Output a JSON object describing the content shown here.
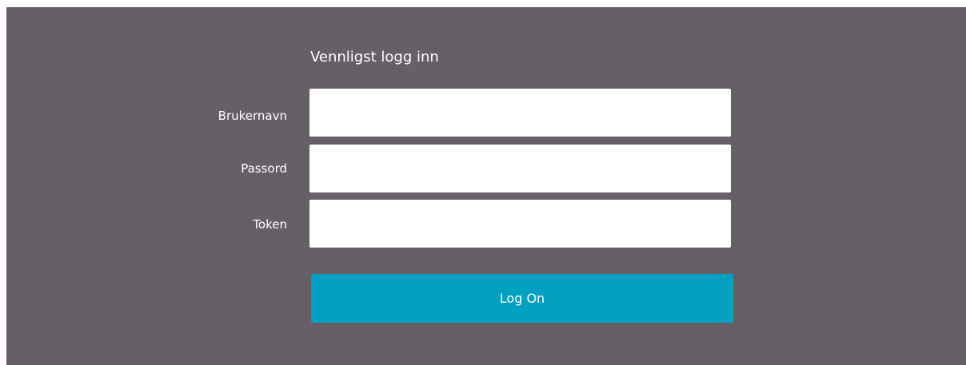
{
  "login": {
    "title": "Vennligst logg inn",
    "fields": [
      {
        "label": "Brukernavn",
        "value": "",
        "placeholder": ""
      },
      {
        "label": "Passord",
        "value": "",
        "placeholder": ""
      },
      {
        "label": "Token",
        "value": "",
        "placeholder": ""
      }
    ],
    "submit_label": "Log On"
  },
  "colors": {
    "panel_background": "#675f68",
    "field_background": "#ffffff",
    "button_background": "#02a1c1",
    "text": "#ffffff"
  }
}
